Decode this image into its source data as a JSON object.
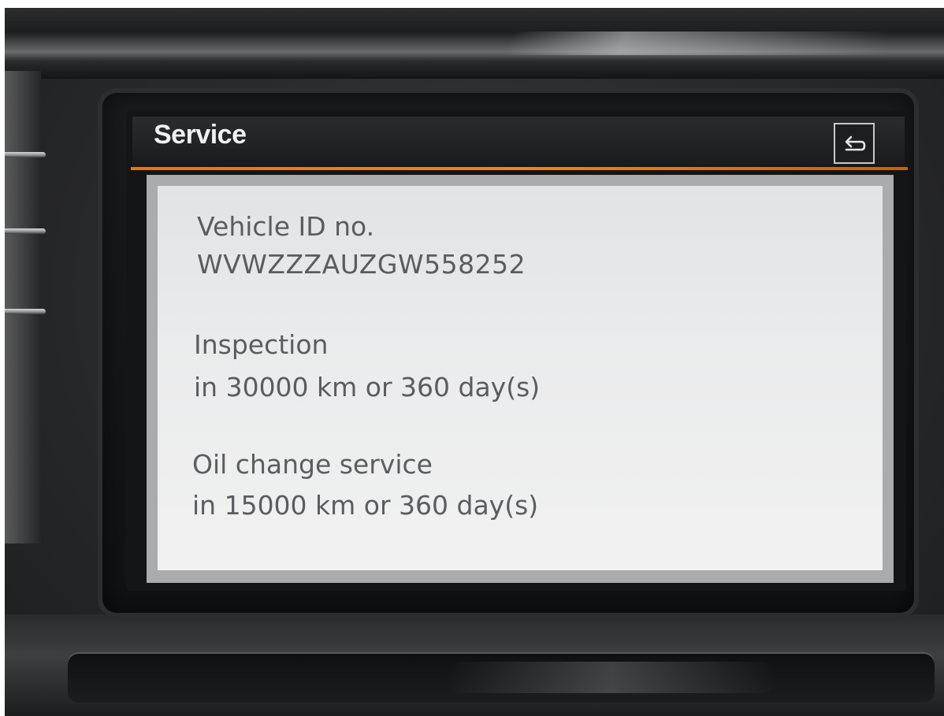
{
  "screen": {
    "title": "Service",
    "back_icon": "back-arrow-icon",
    "accent_color": "#e08a2a"
  },
  "service_info": {
    "vehicle_id_label": "Vehicle ID no.",
    "vehicle_id_value": "WVWZZZAUZGW558252",
    "inspection_label": "Inspection",
    "inspection_value": "in 30000 km or 360 day(s)",
    "oil_change_label": "Oil change service",
    "oil_change_value": "in 15000 km or 360 day(s)"
  }
}
